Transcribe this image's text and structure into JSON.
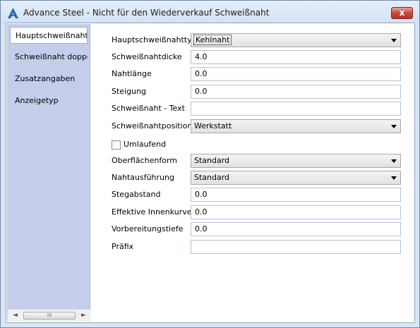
{
  "window": {
    "title": "Advance Steel - Nicht für den Wiederverkauf  Schweißnaht",
    "close_label": "x",
    "icon": "advance-steel-app-icon",
    "colors": {
      "accent": "#3c6ea8",
      "sidebar": "#c4ceeb",
      "close": "#c9463a"
    }
  },
  "sidebar": {
    "items": [
      {
        "label": "Hauptschweißnaht",
        "selected": true
      },
      {
        "label": "Schweißnaht doppelt",
        "selected": false
      },
      {
        "label": "Zusatzangaben",
        "selected": false
      },
      {
        "label": "Anzeigetyp",
        "selected": false
      }
    ],
    "scrollbar": {
      "left": "◄",
      "thumb": "III",
      "right": "►"
    }
  },
  "form": {
    "typ": {
      "label": "Hauptschweißnahttyp",
      "value": "Kehlnaht"
    },
    "dicke": {
      "label": "Schweißnahtdicke",
      "value": "4.0"
    },
    "laenge": {
      "label": "Nahtlänge",
      "value": "0.0"
    },
    "steigung": {
      "label": "Steigung",
      "value": "0.0"
    },
    "text": {
      "label": "Schweißnaht - Text",
      "value": ""
    },
    "position": {
      "label": "Schweißnahtposition",
      "value": "Werkstatt"
    },
    "umlaufend": {
      "label": "Umlaufend",
      "checked": false
    },
    "oberflaeche": {
      "label": "Oberflächenform",
      "value": "Standard"
    },
    "ausfuehrung": {
      "label": "Nahtausführung",
      "value": "Standard"
    },
    "stegabstand": {
      "label": "Stegabstand",
      "value": "0.0"
    },
    "innenkurve": {
      "label": "Effektive Innenkurve",
      "value": "0.0"
    },
    "vorbereitung": {
      "label": "Vorbereitungstiefe",
      "value": "0.0"
    },
    "praefix": {
      "label": "Präfix",
      "value": ""
    }
  }
}
